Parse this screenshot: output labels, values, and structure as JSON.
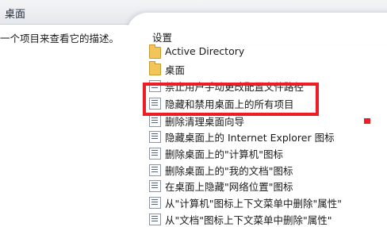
{
  "header": {
    "title": "桌面"
  },
  "description": {
    "text": "一个项目来查看它的描述。"
  },
  "list": {
    "column_header": "设置",
    "items": [
      {
        "label": "Active Directory",
        "type": "folder"
      },
      {
        "label": "桌面",
        "type": "folder"
      },
      {
        "label": "禁止用户手动更改配置文件路径",
        "type": "setting"
      },
      {
        "label": "隐藏和禁用桌面上的所有项目",
        "type": "setting"
      },
      {
        "label": "删除清理桌面向导",
        "type": "setting"
      },
      {
        "label": "隐藏桌面上的 Internet Explorer 图标",
        "type": "setting"
      },
      {
        "label": "删除桌面上的\"计算机\"图标",
        "type": "setting"
      },
      {
        "label": "删除桌面上的\"我的文档\"图标",
        "type": "setting"
      },
      {
        "label": "在桌面上隐藏\"网络位置\"图标",
        "type": "setting"
      },
      {
        "label": "从\"计算机\"图标上下文菜单中删除\"属性\"",
        "type": "setting"
      },
      {
        "label": "从\"文档\"图标上下文菜单中删除\"属性\"",
        "type": "setting"
      }
    ]
  },
  "annotation": {
    "color": "#ee1c24",
    "highlighted_item": "隐藏和禁用桌面上的所有项目"
  }
}
